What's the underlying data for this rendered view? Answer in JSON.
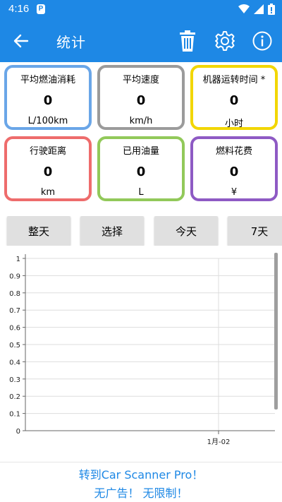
{
  "status_bar": {
    "time": "4:16",
    "app_icon_letter": "P",
    "icons": [
      "wifi-icon",
      "signal-icon",
      "battery-icon"
    ]
  },
  "app_bar": {
    "title": "统计",
    "back_icon": "arrow-left-icon",
    "actions": [
      "trash-icon",
      "gear-icon",
      "info-icon"
    ]
  },
  "colors": {
    "primary": "#1e88e5",
    "card_blue": "#6aa6e8",
    "card_gray": "#9b9b9b",
    "card_yellow": "#f2d600",
    "card_red": "#ee6c6c",
    "card_green": "#92c95a",
    "card_purple": "#8e5ac4"
  },
  "cards": [
    {
      "title": "平均燃油消耗",
      "value": "0",
      "unit": "L/100km"
    },
    {
      "title": "平均速度",
      "value": "0",
      "unit": "km/h"
    },
    {
      "title": "机器运转时间 *",
      "value": "0",
      "unit": "小时"
    },
    {
      "title": "行驶距离",
      "value": "0",
      "unit": "km"
    },
    {
      "title": "已用油量",
      "value": "0",
      "unit": "L"
    },
    {
      "title": "燃料花费",
      "value": "0",
      "unit": "¥"
    }
  ],
  "range_buttons": [
    "整天",
    "选择",
    "今天",
    "7天"
  ],
  "chart_data": {
    "type": "line",
    "title": "",
    "xlabel": "",
    "ylabel": "",
    "ylim": [
      0,
      1
    ],
    "y_ticks": [
      "0",
      "0.1",
      "0.2",
      "0.3",
      "0.4",
      "0.5",
      "0.6",
      "0.7",
      "0.8",
      "0.9",
      "1"
    ],
    "x_ticks": [
      "1月-02"
    ],
    "series": [],
    "grid": true
  },
  "promo": {
    "line1": "转到Car Scanner Pro！",
    "line2": "无广告！ 无限制！"
  }
}
